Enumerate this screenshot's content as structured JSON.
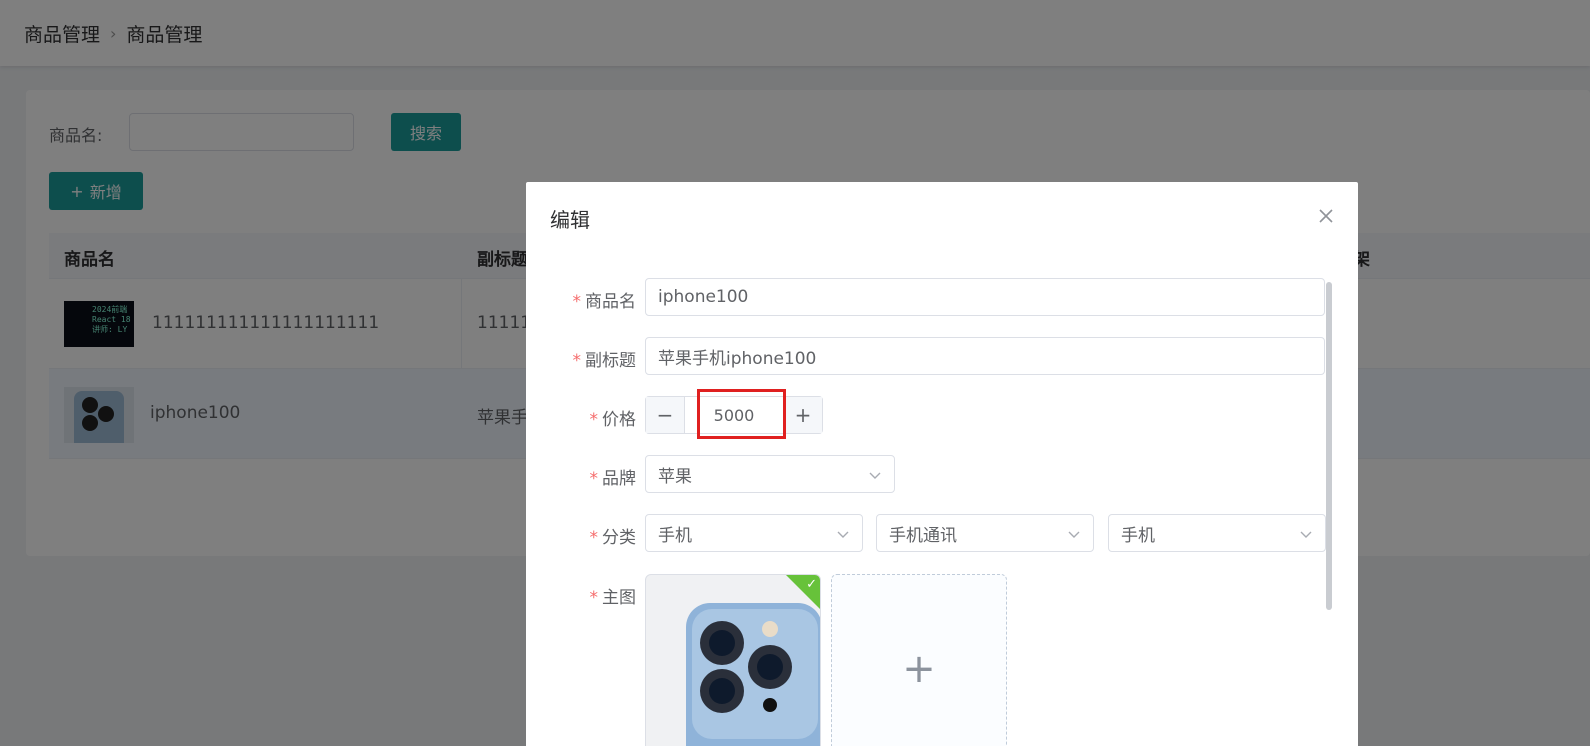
{
  "breadcrumb": {
    "level1": "商品管理",
    "separator": "›",
    "level2": "商品管理"
  },
  "search": {
    "label": "商品名:",
    "value": "",
    "button": "搜索"
  },
  "add_button": {
    "icon": "plus-icon",
    "label": "新增"
  },
  "table": {
    "columns": [
      "商品名",
      "副标题",
      "上架"
    ],
    "rows": [
      {
        "name": "111111111111111111111",
        "subtitle": "11111",
        "thumb_text": [
          "2024前端",
          "React 18",
          "讲师: LY"
        ]
      },
      {
        "name": "iphone100",
        "subtitle": "苹果手"
      }
    ]
  },
  "dialog": {
    "title": "编辑",
    "close_icon": "close-icon",
    "fields": {
      "name": {
        "label": "商品名",
        "value": "iphone100"
      },
      "subtitle": {
        "label": "副标题",
        "value": "苹果手机iphone100"
      },
      "price": {
        "label": "价格",
        "value": "5000",
        "minus": "−",
        "plus": "+"
      },
      "brand": {
        "label": "品牌",
        "value": "苹果"
      },
      "category": {
        "label": "分类",
        "level1": "手机",
        "level2": "手机通讯",
        "level3": "手机"
      },
      "image": {
        "label": "主图",
        "status_icon": "check-icon",
        "add_icon": "plus-icon"
      }
    }
  },
  "colors": {
    "primary": "#1a9c9a",
    "required": "#f56c6c",
    "highlight": "#e02020",
    "success": "#67c23a"
  }
}
